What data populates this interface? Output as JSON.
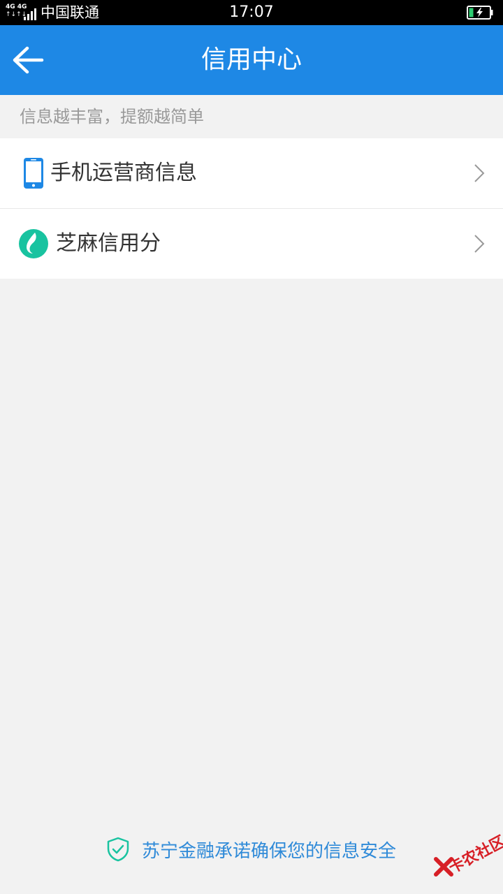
{
  "status_bar": {
    "network_label": "4G 4G",
    "network_arrows": "↑↓↑↓",
    "carrier": "中国联通",
    "time": "17:07",
    "battery_color": "#2ecc71"
  },
  "header": {
    "title": "信用中心",
    "background": "#1e88e5"
  },
  "tip": "信息越丰富，提额越简单",
  "items": [
    {
      "label": "手机运营商信息",
      "icon": "phone-icon"
    },
    {
      "label": "芝麻信用分",
      "icon": "sesame-credit-icon"
    }
  ],
  "footer": {
    "text": "苏宁金融承诺确保您的信息安全",
    "icon": "shield-check-icon"
  },
  "watermark": {
    "text": "卡农社区"
  }
}
